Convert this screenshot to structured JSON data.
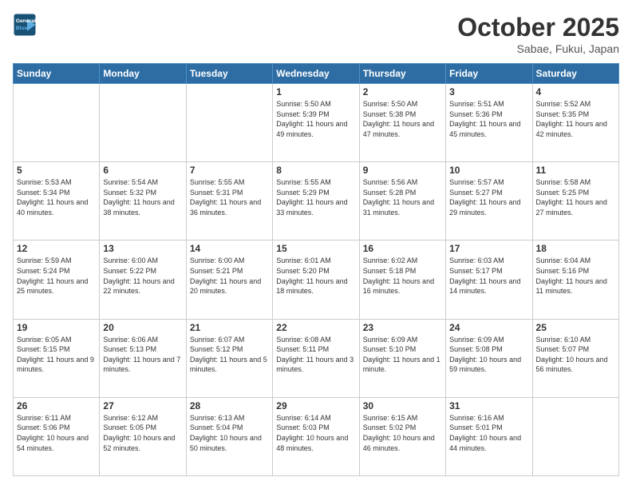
{
  "header": {
    "logo_line1": "General",
    "logo_line2": "Blue",
    "month": "October 2025",
    "location": "Sabae, Fukui, Japan"
  },
  "days_of_week": [
    "Sunday",
    "Monday",
    "Tuesday",
    "Wednesday",
    "Thursday",
    "Friday",
    "Saturday"
  ],
  "weeks": [
    [
      {
        "day": "",
        "sunrise": "",
        "sunset": "",
        "daylight": "",
        "empty": true
      },
      {
        "day": "",
        "sunrise": "",
        "sunset": "",
        "daylight": "",
        "empty": true
      },
      {
        "day": "",
        "sunrise": "",
        "sunset": "",
        "daylight": "",
        "empty": true
      },
      {
        "day": "1",
        "sunrise": "Sunrise: 5:50 AM",
        "sunset": "Sunset: 5:39 PM",
        "daylight": "Daylight: 11 hours and 49 minutes.",
        "empty": false
      },
      {
        "day": "2",
        "sunrise": "Sunrise: 5:50 AM",
        "sunset": "Sunset: 5:38 PM",
        "daylight": "Daylight: 11 hours and 47 minutes.",
        "empty": false
      },
      {
        "day": "3",
        "sunrise": "Sunrise: 5:51 AM",
        "sunset": "Sunset: 5:36 PM",
        "daylight": "Daylight: 11 hours and 45 minutes.",
        "empty": false
      },
      {
        "day": "4",
        "sunrise": "Sunrise: 5:52 AM",
        "sunset": "Sunset: 5:35 PM",
        "daylight": "Daylight: 11 hours and 42 minutes.",
        "empty": false
      }
    ],
    [
      {
        "day": "5",
        "sunrise": "Sunrise: 5:53 AM",
        "sunset": "Sunset: 5:34 PM",
        "daylight": "Daylight: 11 hours and 40 minutes.",
        "empty": false
      },
      {
        "day": "6",
        "sunrise": "Sunrise: 5:54 AM",
        "sunset": "Sunset: 5:32 PM",
        "daylight": "Daylight: 11 hours and 38 minutes.",
        "empty": false
      },
      {
        "day": "7",
        "sunrise": "Sunrise: 5:55 AM",
        "sunset": "Sunset: 5:31 PM",
        "daylight": "Daylight: 11 hours and 36 minutes.",
        "empty": false
      },
      {
        "day": "8",
        "sunrise": "Sunrise: 5:55 AM",
        "sunset": "Sunset: 5:29 PM",
        "daylight": "Daylight: 11 hours and 33 minutes.",
        "empty": false
      },
      {
        "day": "9",
        "sunrise": "Sunrise: 5:56 AM",
        "sunset": "Sunset: 5:28 PM",
        "daylight": "Daylight: 11 hours and 31 minutes.",
        "empty": false
      },
      {
        "day": "10",
        "sunrise": "Sunrise: 5:57 AM",
        "sunset": "Sunset: 5:27 PM",
        "daylight": "Daylight: 11 hours and 29 minutes.",
        "empty": false
      },
      {
        "day": "11",
        "sunrise": "Sunrise: 5:58 AM",
        "sunset": "Sunset: 5:25 PM",
        "daylight": "Daylight: 11 hours and 27 minutes.",
        "empty": false
      }
    ],
    [
      {
        "day": "12",
        "sunrise": "Sunrise: 5:59 AM",
        "sunset": "Sunset: 5:24 PM",
        "daylight": "Daylight: 11 hours and 25 minutes.",
        "empty": false
      },
      {
        "day": "13",
        "sunrise": "Sunrise: 6:00 AM",
        "sunset": "Sunset: 5:22 PM",
        "daylight": "Daylight: 11 hours and 22 minutes.",
        "empty": false
      },
      {
        "day": "14",
        "sunrise": "Sunrise: 6:00 AM",
        "sunset": "Sunset: 5:21 PM",
        "daylight": "Daylight: 11 hours and 20 minutes.",
        "empty": false
      },
      {
        "day": "15",
        "sunrise": "Sunrise: 6:01 AM",
        "sunset": "Sunset: 5:20 PM",
        "daylight": "Daylight: 11 hours and 18 minutes.",
        "empty": false
      },
      {
        "day": "16",
        "sunrise": "Sunrise: 6:02 AM",
        "sunset": "Sunset: 5:18 PM",
        "daylight": "Daylight: 11 hours and 16 minutes.",
        "empty": false
      },
      {
        "day": "17",
        "sunrise": "Sunrise: 6:03 AM",
        "sunset": "Sunset: 5:17 PM",
        "daylight": "Daylight: 11 hours and 14 minutes.",
        "empty": false
      },
      {
        "day": "18",
        "sunrise": "Sunrise: 6:04 AM",
        "sunset": "Sunset: 5:16 PM",
        "daylight": "Daylight: 11 hours and 11 minutes.",
        "empty": false
      }
    ],
    [
      {
        "day": "19",
        "sunrise": "Sunrise: 6:05 AM",
        "sunset": "Sunset: 5:15 PM",
        "daylight": "Daylight: 11 hours and 9 minutes.",
        "empty": false
      },
      {
        "day": "20",
        "sunrise": "Sunrise: 6:06 AM",
        "sunset": "Sunset: 5:13 PM",
        "daylight": "Daylight: 11 hours and 7 minutes.",
        "empty": false
      },
      {
        "day": "21",
        "sunrise": "Sunrise: 6:07 AM",
        "sunset": "Sunset: 5:12 PM",
        "daylight": "Daylight: 11 hours and 5 minutes.",
        "empty": false
      },
      {
        "day": "22",
        "sunrise": "Sunrise: 6:08 AM",
        "sunset": "Sunset: 5:11 PM",
        "daylight": "Daylight: 11 hours and 3 minutes.",
        "empty": false
      },
      {
        "day": "23",
        "sunrise": "Sunrise: 6:09 AM",
        "sunset": "Sunset: 5:10 PM",
        "daylight": "Daylight: 11 hours and 1 minute.",
        "empty": false
      },
      {
        "day": "24",
        "sunrise": "Sunrise: 6:09 AM",
        "sunset": "Sunset: 5:08 PM",
        "daylight": "Daylight: 10 hours and 59 minutes.",
        "empty": false
      },
      {
        "day": "25",
        "sunrise": "Sunrise: 6:10 AM",
        "sunset": "Sunset: 5:07 PM",
        "daylight": "Daylight: 10 hours and 56 minutes.",
        "empty": false
      }
    ],
    [
      {
        "day": "26",
        "sunrise": "Sunrise: 6:11 AM",
        "sunset": "Sunset: 5:06 PM",
        "daylight": "Daylight: 10 hours and 54 minutes.",
        "empty": false
      },
      {
        "day": "27",
        "sunrise": "Sunrise: 6:12 AM",
        "sunset": "Sunset: 5:05 PM",
        "daylight": "Daylight: 10 hours and 52 minutes.",
        "empty": false
      },
      {
        "day": "28",
        "sunrise": "Sunrise: 6:13 AM",
        "sunset": "Sunset: 5:04 PM",
        "daylight": "Daylight: 10 hours and 50 minutes.",
        "empty": false
      },
      {
        "day": "29",
        "sunrise": "Sunrise: 6:14 AM",
        "sunset": "Sunset: 5:03 PM",
        "daylight": "Daylight: 10 hours and 48 minutes.",
        "empty": false
      },
      {
        "day": "30",
        "sunrise": "Sunrise: 6:15 AM",
        "sunset": "Sunset: 5:02 PM",
        "daylight": "Daylight: 10 hours and 46 minutes.",
        "empty": false
      },
      {
        "day": "31",
        "sunrise": "Sunrise: 6:16 AM",
        "sunset": "Sunset: 5:01 PM",
        "daylight": "Daylight: 10 hours and 44 minutes.",
        "empty": false
      },
      {
        "day": "",
        "sunrise": "",
        "sunset": "",
        "daylight": "",
        "empty": true
      }
    ]
  ]
}
